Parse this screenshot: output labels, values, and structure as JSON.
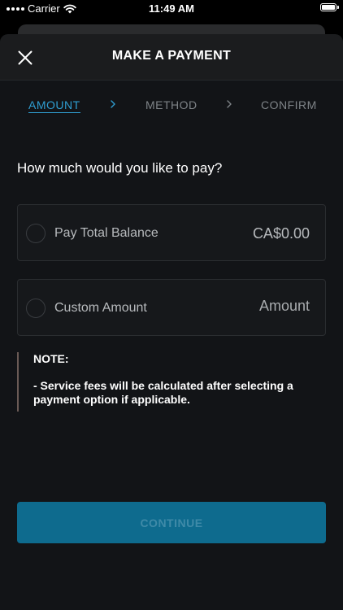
{
  "status_bar": {
    "carrier": "Carrier",
    "time": "11:49 AM"
  },
  "header": {
    "title": "MAKE A PAYMENT",
    "close_icon": "close-icon"
  },
  "steps": [
    {
      "label": "AMOUNT",
      "active": true
    },
    {
      "label": "METHOD",
      "active": false
    },
    {
      "label": "CONFIRM",
      "active": false
    }
  ],
  "question": "How much would you like to pay?",
  "options": {
    "total": {
      "label": "Pay Total Balance",
      "value": "CA$0.00"
    },
    "custom": {
      "label": "Custom Amount",
      "placeholder": "Amount"
    }
  },
  "note": {
    "title": "NOTE:",
    "body": " - Service fees will be calculated after selecting a payment option if applicable."
  },
  "continue_label": "CONTINUE",
  "colors": {
    "accent": "#2f9ed1",
    "button": "#0e6b8e",
    "sheet_bg": "#121417"
  }
}
